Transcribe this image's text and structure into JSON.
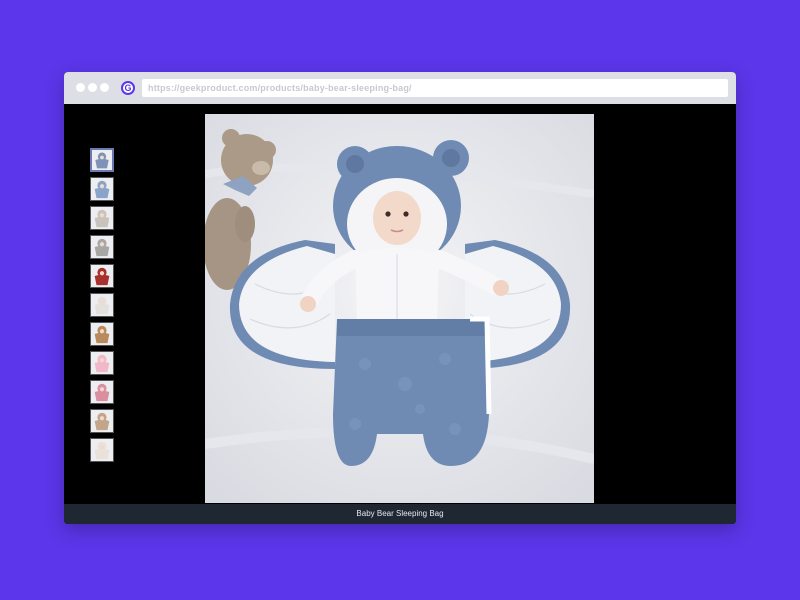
{
  "browser": {
    "url": "https://geekproduct.com/products/baby-bear-sleeping-bag/",
    "favicon_letter": "G"
  },
  "gallery": {
    "caption": "Baby Bear Sleeping Bag",
    "active_index": 0,
    "thumbnails": [
      {
        "name": "blue",
        "color": "#7f93b8"
      },
      {
        "name": "blue-alt",
        "color": "#8aa3c8"
      },
      {
        "name": "gray-light",
        "color": "#c9c3bb"
      },
      {
        "name": "gray",
        "color": "#a9a6a6"
      },
      {
        "name": "red",
        "color": "#a8312b"
      },
      {
        "name": "white",
        "color": "#e4e0dc"
      },
      {
        "name": "tan",
        "color": "#b98a5c"
      },
      {
        "name": "pink",
        "color": "#f1b9c8"
      },
      {
        "name": "pink-dark",
        "color": "#d98fa0"
      },
      {
        "name": "beige",
        "color": "#c3a58a"
      },
      {
        "name": "cream",
        "color": "#e8e2da"
      }
    ]
  },
  "colors": {
    "background": "#5b36ea",
    "caption_bar": "#1f2733"
  }
}
